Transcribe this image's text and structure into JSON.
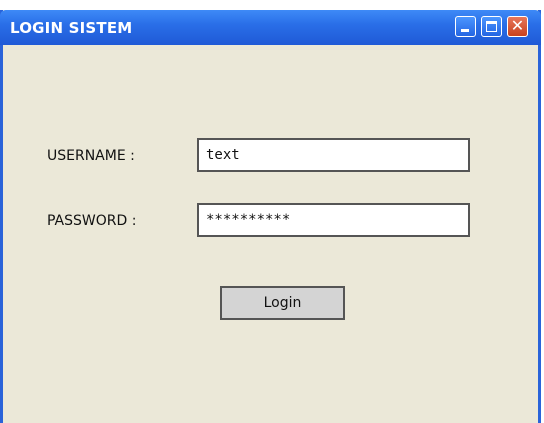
{
  "window": {
    "title": "LOGIN SISTEM",
    "controls": {
      "minimize_icon": "minimize-icon",
      "maximize_icon": "maximize-icon",
      "close_glyph": "✕"
    }
  },
  "form": {
    "username_label": "USERNAME :",
    "username_value": "text",
    "password_label": "PASSWORD :",
    "password_value": "**********",
    "login_label": "Login"
  },
  "colors": {
    "titlebar": "#2a6fe8",
    "background": "#ebe8d8",
    "close_button": "#d2542f",
    "login_button": "#d4d4d4"
  }
}
